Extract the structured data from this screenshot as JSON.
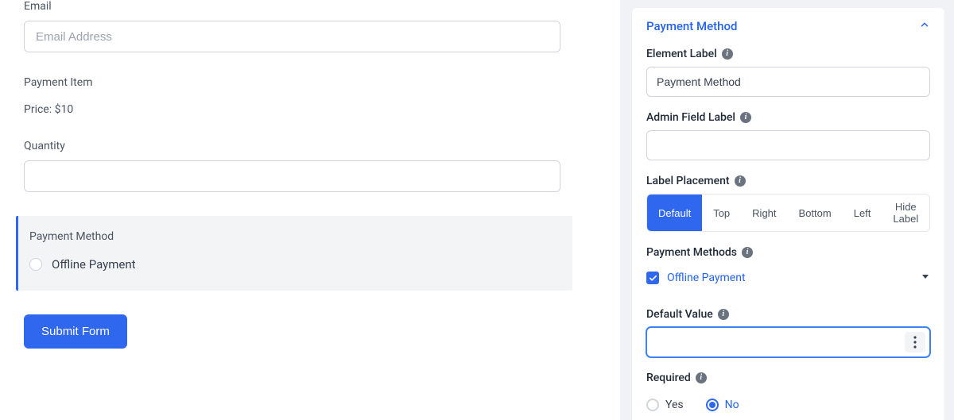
{
  "preview": {
    "email_label": "Email",
    "email_placeholder": "Email Address",
    "payment_item_label": "Payment Item",
    "price_text": "Price: $10",
    "quantity_label": "Quantity",
    "payment_method_label": "Payment Method",
    "payment_method_option": "Offline Payment",
    "submit_label": "Submit Form"
  },
  "sidebar": {
    "panel_title": "Payment Method",
    "element_label": {
      "title": "Element Label",
      "value": "Payment Method"
    },
    "admin_field_label": {
      "title": "Admin Field Label",
      "value": ""
    },
    "label_placement": {
      "title": "Label Placement",
      "options": [
        "Default",
        "Top",
        "Right",
        "Bottom",
        "Left",
        "Hide Label"
      ],
      "selected": "Default"
    },
    "payment_methods": {
      "title": "Payment Methods",
      "item_label": "Offline Payment",
      "checked": true
    },
    "default_value": {
      "title": "Default Value",
      "value": ""
    },
    "required": {
      "title": "Required",
      "yes": "Yes",
      "no": "No",
      "selected": "No"
    }
  }
}
